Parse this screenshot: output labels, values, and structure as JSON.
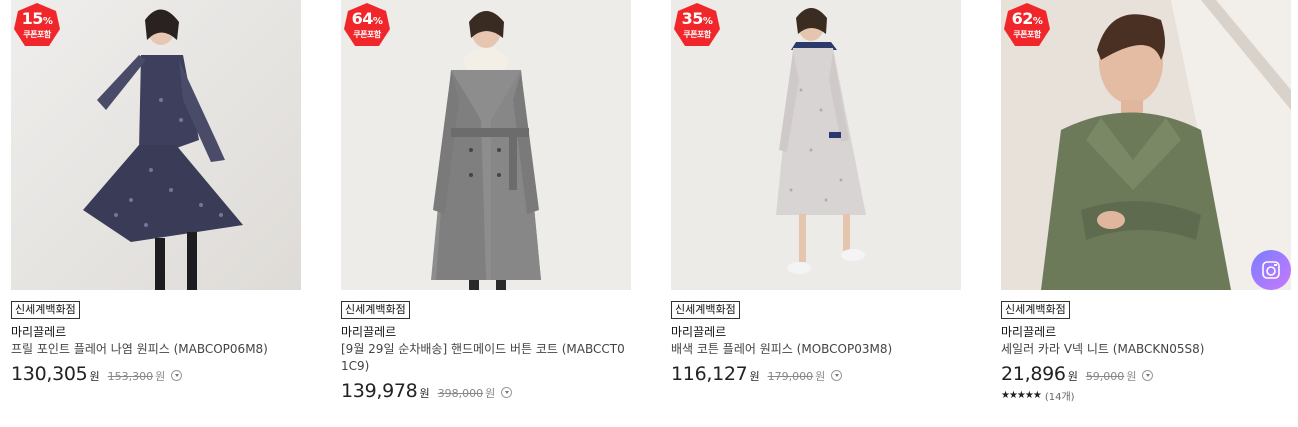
{
  "badge_color": "#f1262b",
  "products": [
    {
      "discount_number": "15",
      "discount_unit": "%",
      "coupon_label": "쿠폰포함",
      "store": "신세계백화점",
      "brand": "마리끌레르",
      "name": "프릴 포인트 플레어 나염 원피스 (MABCOP06M8)",
      "price": "130,305",
      "price_unit": "원",
      "original_price": "153,300",
      "original_unit": "원"
    },
    {
      "discount_number": "64",
      "discount_unit": "%",
      "coupon_label": "쿠폰포함",
      "store": "신세계백화점",
      "brand": "마리끌레르",
      "name": "[9월 29일 순차배송] 핸드메이드 버튼 코트 (MABCCT01C9)",
      "price": "139,978",
      "price_unit": "원",
      "original_price": "398,000",
      "original_unit": "원"
    },
    {
      "discount_number": "35",
      "discount_unit": "%",
      "coupon_label": "쿠폰포함",
      "store": "신세계백화점",
      "brand": "마리끌레르",
      "name": "배색 코튼 플레어 원피스 (MOBCOP03M8)",
      "price": "116,127",
      "price_unit": "원",
      "original_price": "179,000",
      "original_unit": "원"
    },
    {
      "discount_number": "62",
      "discount_unit": "%",
      "coupon_label": "쿠폰포함",
      "store": "신세계백화점",
      "brand": "마리끌레르",
      "name": "세일러 카라 V넥 니트 (MABCKN05S8)",
      "price": "21,896",
      "price_unit": "원",
      "original_price": "59,000",
      "original_unit": "원",
      "rating_stars": "★★★★★",
      "rating_count": "(14개)",
      "rating_value": 5
    }
  ],
  "icons": {
    "info": "chevron-down-circle-icon",
    "review": "camera-icon"
  }
}
